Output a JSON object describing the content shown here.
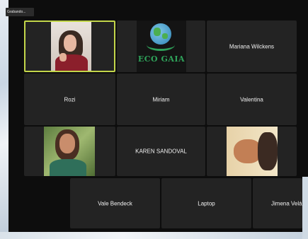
{
  "recording_badge": "Grabando...",
  "participants": {
    "eco_gaia": {
      "logo_text": "ECO GAIA"
    },
    "mariana": {
      "name": "Mariana Wilckens"
    },
    "rozi": {
      "name": "Rozi"
    },
    "miriam": {
      "name": "Miriam"
    },
    "valentina": {
      "name": "Valentina"
    },
    "karen": {
      "name": "KAREN SANDOVAL"
    },
    "vale": {
      "name": "Vale Bendeck"
    },
    "laptop": {
      "name": "Laptop"
    },
    "jimena": {
      "name": "Jimena Velás"
    }
  },
  "colors": {
    "tile_bg": "#232323",
    "active_speaker_border": "#c3d64a",
    "eco_gaia_green": "#2fa35a"
  }
}
